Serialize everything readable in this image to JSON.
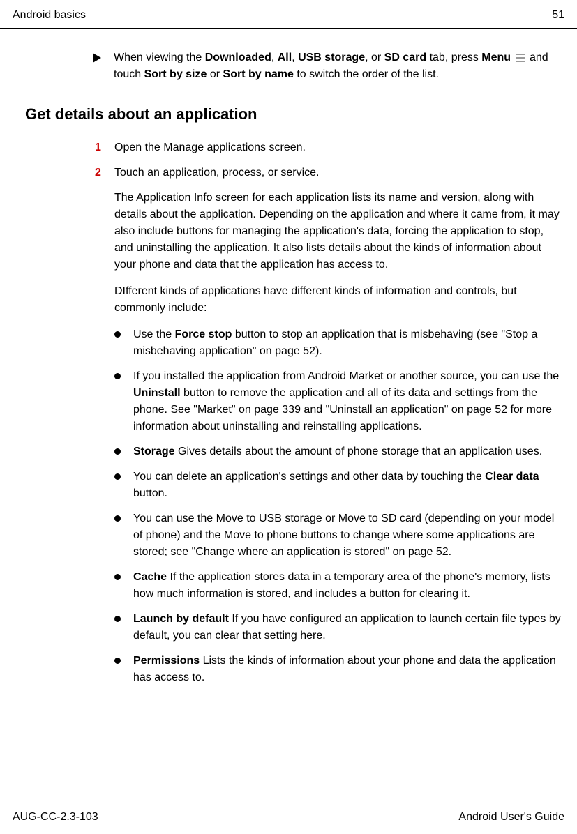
{
  "header": {
    "left": "Android basics",
    "right": "51"
  },
  "intro": {
    "prefix": "When viewing the ",
    "b1": "Downloaded",
    "c1": ", ",
    "b2": "All",
    "c2": ", ",
    "b3": "USB storage",
    "c3": ", or ",
    "b4": "SD card",
    "mid1": " tab, press ",
    "b5": "Menu",
    "mid2": " and touch ",
    "b6": "Sort by size",
    "mid3": " or ",
    "b7": "Sort by name",
    "suffix": " to switch the order of the list."
  },
  "heading": "Get details about an application",
  "steps": {
    "n1": "1",
    "t1": "Open the Manage applications screen.",
    "n2": "2",
    "t2": "Touch an application, process, or service."
  },
  "para1": "The Application Info screen for each application lists its name and version, along with details about the application. Depending on the application and where it came from, it may also include buttons for managing the application's data, forcing the application to stop, and uninstalling the application. It also lists details about the kinds of information about your phone and data that the application has access to.",
  "para2": "DIfferent kinds of applications have different kinds of information and controls, but commonly include:",
  "bullets": {
    "item1": {
      "pre": "Use the ",
      "b": "Force stop",
      "post": " button to stop an application that is misbehaving (see \"Stop a misbehaving application\" on page 52)."
    },
    "item2": {
      "pre": "If you installed the application from Android Market or another source, you can use the ",
      "b": "Uninstall",
      "post": " button to remove the application and all of its data and settings from the phone. See \"Market\" on page 339 and \"Uninstall an application\" on page 52 for more information about uninstalling and reinstalling applications."
    },
    "item3": {
      "b": "Storage",
      "post": " Gives details about the amount of phone storage that an application uses."
    },
    "item4": {
      "pre": "You can delete an application's settings and other data by touching the ",
      "b": "Clear data",
      "post": " button."
    },
    "item5": {
      "text": "You can use the Move to USB storage or Move to SD card (depending on your model of phone) and the Move to phone buttons to change where some applications are stored; see \"Change where an application is stored\" on page 52."
    },
    "item6": {
      "b": "Cache",
      "post": " If the application stores data in a temporary area of the phone's memory, lists how much information is stored, and includes a button for clearing it."
    },
    "item7": {
      "b": "Launch by default",
      "post": " If you have configured an application to launch certain file types by default, you can clear that setting here."
    },
    "item8": {
      "b": "Permissions",
      "post": " Lists the kinds of information about your phone and data the application has access to."
    }
  },
  "footer": {
    "left": "AUG-CC-2.3-103",
    "right": "Android User's Guide"
  }
}
